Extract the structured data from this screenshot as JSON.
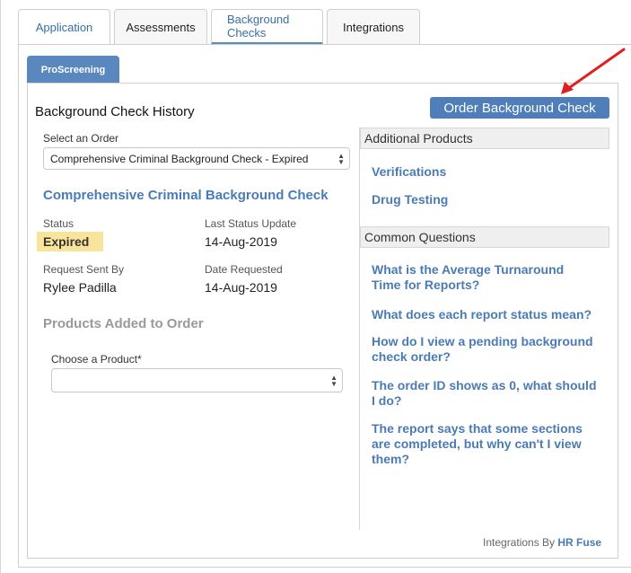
{
  "tabs": [
    {
      "label": "Application"
    },
    {
      "label": "Assessments"
    },
    {
      "label": "Background Checks"
    },
    {
      "label": "Integrations"
    }
  ],
  "subtab": {
    "label": "ProScreening"
  },
  "history": {
    "title": "Background Check History",
    "order_button": "Order Background Check"
  },
  "order": {
    "select_label": "Select an Order",
    "selected_value": "Comprehensive Criminal Background Check - Expired",
    "name": "Comprehensive Criminal Background Check",
    "status_label": "Status",
    "status_value": "Expired",
    "status_color": "#f8e59b",
    "last_update_label": "Last Status Update",
    "last_update_value": "14-Aug-2019",
    "sent_by_label": "Request Sent By",
    "sent_by_value": "Rylee Padilla",
    "date_requested_label": "Date Requested",
    "date_requested_value": "14-Aug-2019"
  },
  "products": {
    "title": "Products Added to Order",
    "choose_label": "Choose a Product*",
    "choose_value": ""
  },
  "additional": {
    "title": "Additional Products",
    "items": [
      "Verifications",
      "Drug Testing"
    ]
  },
  "questions": {
    "title": "Common Questions",
    "items": [
      "What is the Average Turnaround Time for Reports?",
      "What does each report status mean?",
      "How do I view a pending background check order?",
      "The order ID shows as 0, what should I do?",
      "The report says that some sections are completed, but why can't I view them?"
    ]
  },
  "footer": {
    "prefix": "Integrations By",
    "brand": "HR Fuse"
  },
  "colors": {
    "accent": "#4f7eb8",
    "link": "#4a7bb5",
    "arrow": "#e02020"
  }
}
